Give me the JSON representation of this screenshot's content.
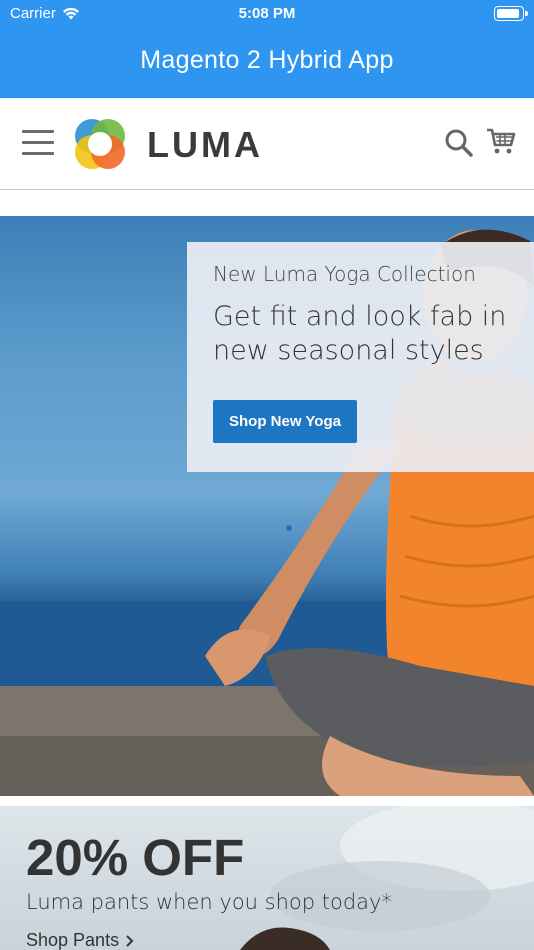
{
  "status_bar": {
    "carrier": "Carrier",
    "time": "5:08 PM"
  },
  "app_bar": {
    "title": "Magento 2 Hybrid App",
    "color": "#2e96f0"
  },
  "header": {
    "brand": "LUMA",
    "icons": [
      "menu-icon",
      "luma-logo",
      "search-icon",
      "cart-icon"
    ]
  },
  "hero": {
    "eyebrow": "New Luma Yoga Collection",
    "headline": "Get fit and look fab in new seasonal styles",
    "button_label": "Shop New Yoga",
    "button_color": "#1d76c2"
  },
  "promo": {
    "title": "20% OFF",
    "subtitle": "Luma pants when you shop today*",
    "link_label": "Shop Pants"
  }
}
